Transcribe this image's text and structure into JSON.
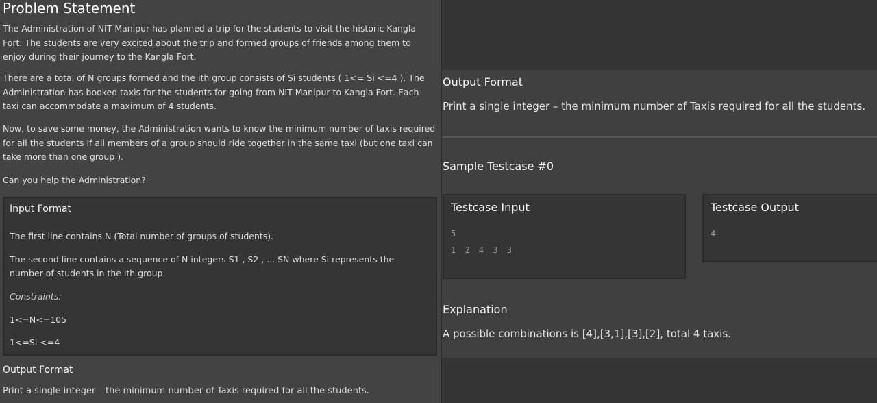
{
  "left": {
    "title": "Problem Statement",
    "p1": "The Administration of NIT Manipur has planned a trip for the students to visit the historic Kangla Fort. The students are very excited about the trip and formed groups of friends among them to enjoy during their journey to the Kangla Fort.",
    "p2": "There are a total of N groups formed and the ith group consists of Si students ( 1<= Si <=4 ). The Administration has booked taxis for the students for going from NIT Manipur to Kangla Fort. Each taxi can accommodate a maximum of 4 students.",
    "p3": "Now, to save some money, the Administration wants to know the minimum number of taxis required for all the students if all members of a group should ride together in the same taxi (but one taxi can take more than one group ).",
    "p4": "Can you help the Administration?",
    "input_format": {
      "title": "Input Format",
      "line1": "The first line contains N (Total number of groups of students).",
      "line2": "The second line contains a sequence of N integers S1 , S2 , ... SN where Si represents the number of students in the ith group.",
      "constraints_label": "Constraints:",
      "constraint1": "1<=N<=105",
      "constraint2": "1<=Si <=4"
    },
    "output_format": {
      "title": "Output Format",
      "text": "Print a single integer – the minimum number of Taxis required for all the students."
    }
  },
  "right": {
    "output_format": {
      "title": "Output Format",
      "text": "Print a single integer – the minimum number of Taxis required for all the students."
    },
    "sample_title": "Sample Testcase #0",
    "testcase_input": {
      "title": "Testcase Input",
      "line1": "5",
      "line2": "1 2 4 3 3"
    },
    "testcase_output": {
      "title": "Testcase Output",
      "line1": "4"
    },
    "explanation": {
      "title": "Explanation",
      "text": "A possible combinations is [4],[3,1],[3],[2], total 4 taxis."
    }
  }
}
